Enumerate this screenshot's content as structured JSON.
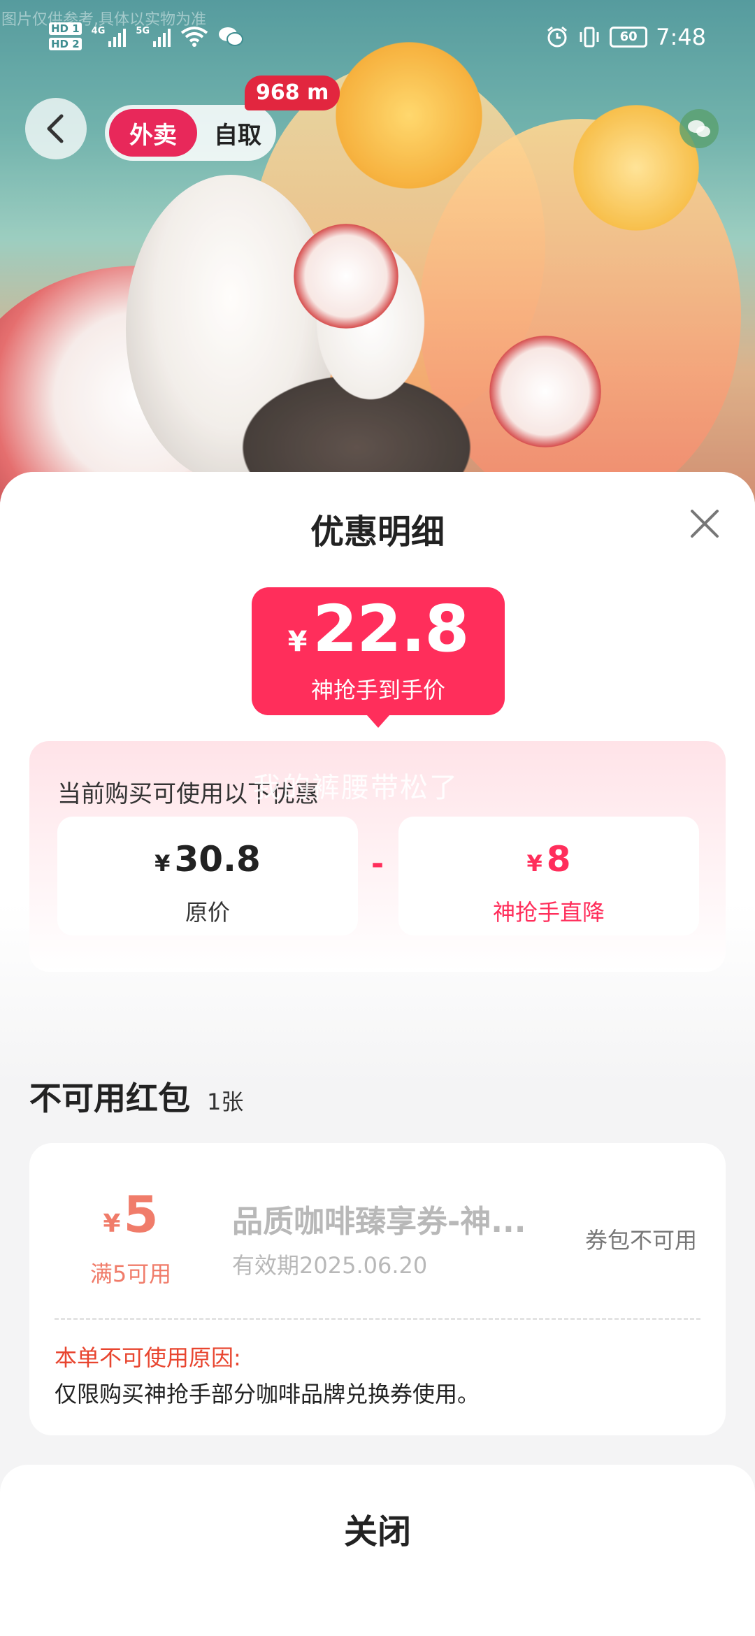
{
  "banner": {
    "watermark": "图片仅供参考,具体以实物为准",
    "distance_badge": "968 m",
    "mode_tabs": [
      {
        "label": "外卖",
        "active": true
      },
      {
        "label": "自取",
        "active": false
      }
    ]
  },
  "status_bar": {
    "time": "7:48",
    "battery": "60",
    "network_1": "4G",
    "network_2": "5G",
    "sim_1": "HD 1",
    "sim_2": "HD 2"
  },
  "sheet": {
    "title": "优惠明细",
    "final_price": {
      "currency": "¥",
      "amount": "22.8",
      "label": "神抢手到手价"
    },
    "discounts": {
      "heading": "当前购买可使用以下优惠",
      "overlay_watermark": "我的裤腰带松了",
      "original": {
        "currency": "¥",
        "amount": "30.8",
        "label": "原价"
      },
      "operator": "-",
      "reduction": {
        "currency": "¥",
        "amount": "8",
        "label": "神抢手直降"
      }
    },
    "unavailable": {
      "title": "不可用红包",
      "count": "1张",
      "coupon": {
        "currency": "¥",
        "amount": "5",
        "condition": "满5可用",
        "name": "品质咖啡臻享券-神...",
        "expiry": "有效期2025.06.20",
        "status": "券包不可用",
        "reason_heading": "本单不可使用原因:",
        "reason": "仅限购买神抢手部分咖啡品牌兑换券使用。"
      }
    },
    "close_label": "关闭"
  },
  "colors": {
    "accent": "#ff2e5b",
    "tab_active": "#e8285a",
    "coupon_amount": "#f07c6a",
    "reason_heading": "#e8452f"
  }
}
